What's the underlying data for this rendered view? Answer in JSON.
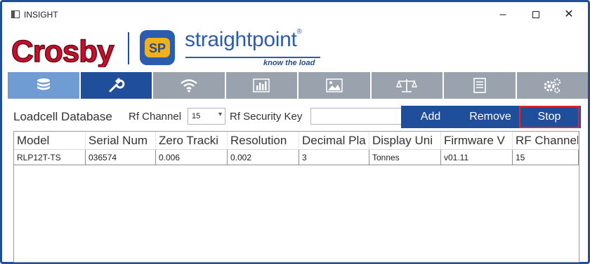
{
  "window": {
    "title": "INSIGHT",
    "minimize_glyph": "–",
    "close_glyph": "✕"
  },
  "brand": {
    "crosby": "Crosby",
    "sp_badge": "SP",
    "name": "straightpoint",
    "registered": "®",
    "tagline": "know the load"
  },
  "tabs": [
    {
      "icon": "database-icon",
      "active": false
    },
    {
      "icon": "wrench-icon",
      "active": true
    },
    {
      "icon": "wifi-icon",
      "active": false
    },
    {
      "icon": "bar-chart-icon",
      "active": false
    },
    {
      "icon": "image-icon",
      "active": false
    },
    {
      "icon": "scale-icon",
      "active": false
    },
    {
      "icon": "document-icon",
      "active": false
    },
    {
      "icon": "gears-icon",
      "active": false
    }
  ],
  "toolbar": {
    "section_label": "Loadcell Database",
    "rf_channel_label": "Rf Channel",
    "rf_channel_value": "15",
    "security_key_label": "Rf Security Key",
    "security_key_value": "",
    "add_label": "Add",
    "remove_label": "Remove",
    "stop_label": "Stop"
  },
  "table": {
    "columns": [
      "Model",
      "Serial Num",
      "Zero Tracki",
      "Resolution",
      "Decimal Pla",
      "Display Uni",
      "Firmware V",
      "RF Channel"
    ],
    "rows": [
      [
        "RLP12T-TS",
        "036574",
        "0.006",
        "0.002",
        "3",
        "Tonnes",
        "v01.11",
        "15"
      ]
    ]
  },
  "colors": {
    "accent": "#1f4e9a",
    "tab_inactive": "#9aa3ad",
    "tab_db": "#6f9cd3",
    "crosby_red": "#c8102e",
    "sp_blue": "#2a5db0",
    "sp_yellow": "#f2b01e",
    "highlight": "#e3262a"
  }
}
